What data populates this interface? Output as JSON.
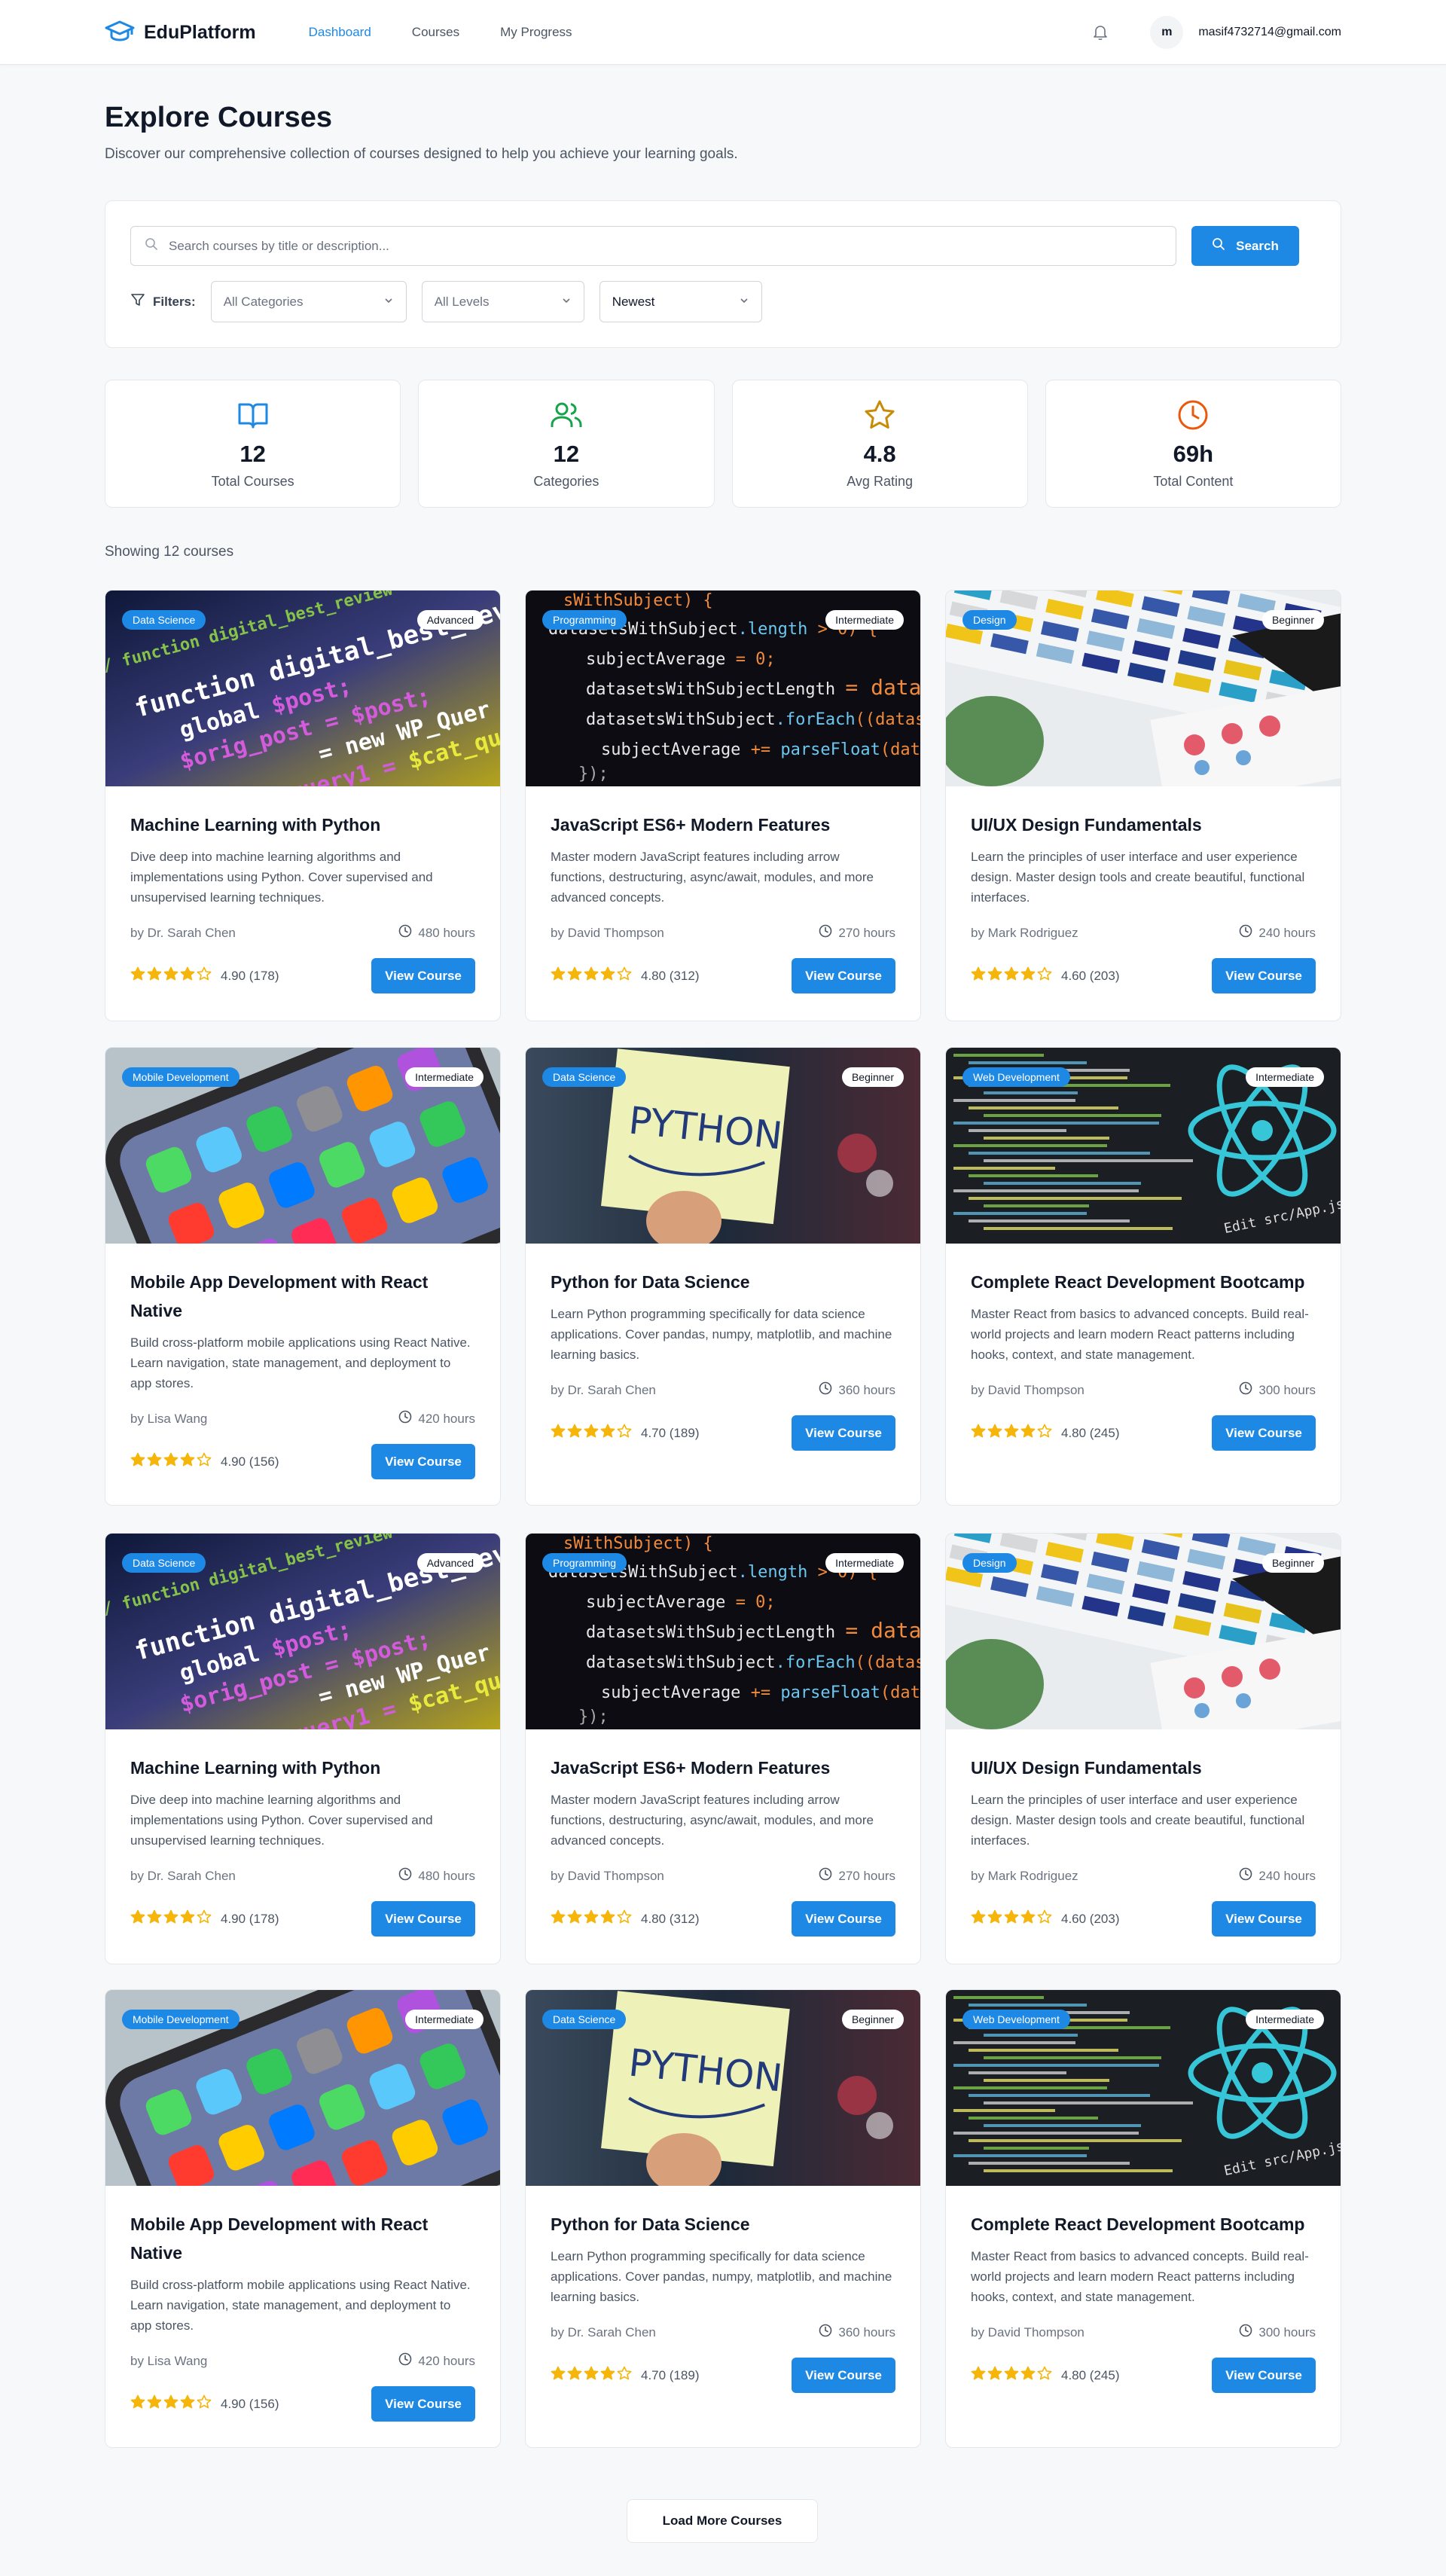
{
  "nav": {
    "brand": "EduPlatform",
    "links": [
      "Dashboard",
      "Courses",
      "My Progress"
    ],
    "active": "Dashboard",
    "avatar_initial": "m",
    "user_email": "masif4732714@gmail.com"
  },
  "header": {
    "title": "Explore Courses",
    "subtitle": "Discover our comprehensive collection of courses designed to help you achieve your learning goals."
  },
  "search": {
    "placeholder": "Search courses by title or description...",
    "button_label": "Search",
    "filters_label": "Filters:",
    "category_select": "All Categories",
    "level_select": "All Levels",
    "sort_select": "Newest"
  },
  "stats": [
    {
      "icon": "book-open-icon",
      "value": "12",
      "label": "Total Courses",
      "color": "#1e88e5"
    },
    {
      "icon": "users-icon",
      "value": "12",
      "label": "Categories",
      "color": "#16a34a"
    },
    {
      "icon": "star-outline-icon",
      "value": "4.8",
      "label": "Avg Rating",
      "color": "#ca8a04"
    },
    {
      "icon": "clock-icon",
      "value": "69h",
      "label": "Total Content",
      "color": "#ea580c"
    }
  ],
  "showing_text": "Showing 12 courses",
  "courses": [
    {
      "category": "Data Science",
      "level": "Advanced",
      "title": "Machine Learning with Python",
      "description": "Dive deep into machine learning algorithms and implementations using Python. Cover supervised and unsupervised learning techniques.",
      "instructor": "by Dr. Sarah Chen",
      "hours": "480 hours",
      "stars": 4,
      "rating": "4.90 (178)",
      "button": "View Course",
      "image": "code-wordpress"
    },
    {
      "category": "Programming",
      "level": "Intermediate",
      "title": "JavaScript ES6+ Modern Features",
      "description": "Master modern JavaScript features including arrow functions, destructuring, async/await, modules, and more advanced concepts.",
      "instructor": "by David Thompson",
      "hours": "270 hours",
      "stars": 4,
      "rating": "4.80 (312)",
      "button": "View Course",
      "image": "code-javascript"
    },
    {
      "category": "Design",
      "level": "Beginner",
      "title": "UI/UX Design Fundamentals",
      "description": "Learn the principles of user interface and user experience design. Master design tools and create beautiful, functional interfaces.",
      "instructor": "by Mark Rodriguez",
      "hours": "240 hours",
      "stars": 4,
      "rating": "4.60 (203)",
      "button": "View Course",
      "image": "design-swatches"
    },
    {
      "category": "Mobile Development",
      "level": "Intermediate",
      "title": "Mobile App Development with React Native",
      "description": "Build cross-platform mobile applications using React Native. Learn navigation, state management, and deployment to app stores.",
      "instructor": "by Lisa Wang",
      "hours": "420 hours",
      "stars": 4,
      "rating": "4.90 (156)",
      "button": "View Course",
      "image": "phone-apps"
    },
    {
      "category": "Data Science",
      "level": "Beginner",
      "title": "Python for Data Science",
      "description": "Learn Python programming specifically for data science applications. Cover pandas, numpy, matplotlib, and machine learning basics.",
      "instructor": "by Dr. Sarah Chen",
      "hours": "360 hours",
      "stars": 4,
      "rating": "4.70 (189)",
      "button": "View Course",
      "image": "python-note"
    },
    {
      "category": "Web Development",
      "level": "Intermediate",
      "title": "Complete React Development Bootcamp",
      "description": "Master React from basics to advanced concepts. Build real-world projects and learn modern React patterns including hooks, context, and state management.",
      "instructor": "by David Thompson",
      "hours": "300 hours",
      "stars": 4,
      "rating": "4.80 (245)",
      "button": "View Course",
      "image": "react-screen"
    },
    {
      "category": "Data Science",
      "level": "Advanced",
      "title": "Machine Learning with Python",
      "description": "Dive deep into machine learning algorithms and implementations using Python. Cover supervised and unsupervised learning techniques.",
      "instructor": "by Dr. Sarah Chen",
      "hours": "480 hours",
      "stars": 4,
      "rating": "4.90 (178)",
      "button": "View Course",
      "image": "code-wordpress"
    },
    {
      "category": "Programming",
      "level": "Intermediate",
      "title": "JavaScript ES6+ Modern Features",
      "description": "Master modern JavaScript features including arrow functions, destructuring, async/await, modules, and more advanced concepts.",
      "instructor": "by David Thompson",
      "hours": "270 hours",
      "stars": 4,
      "rating": "4.80 (312)",
      "button": "View Course",
      "image": "code-javascript"
    },
    {
      "category": "Design",
      "level": "Beginner",
      "title": "UI/UX Design Fundamentals",
      "description": "Learn the principles of user interface and user experience design. Master design tools and create beautiful, functional interfaces.",
      "instructor": "by Mark Rodriguez",
      "hours": "240 hours",
      "stars": 4,
      "rating": "4.60 (203)",
      "button": "View Course",
      "image": "design-swatches"
    },
    {
      "category": "Mobile Development",
      "level": "Intermediate",
      "title": "Mobile App Development with React Native",
      "description": "Build cross-platform mobile applications using React Native. Learn navigation, state management, and deployment to app stores.",
      "instructor": "by Lisa Wang",
      "hours": "420 hours",
      "stars": 4,
      "rating": "4.90 (156)",
      "button": "View Course",
      "image": "phone-apps"
    },
    {
      "category": "Data Science",
      "level": "Beginner",
      "title": "Python for Data Science",
      "description": "Learn Python programming specifically for data science applications. Cover pandas, numpy, matplotlib, and machine learning basics.",
      "instructor": "by Dr. Sarah Chen",
      "hours": "360 hours",
      "stars": 4,
      "rating": "4.70 (189)",
      "button": "View Course",
      "image": "python-note"
    },
    {
      "category": "Web Development",
      "level": "Intermediate",
      "title": "Complete React Development Bootcamp",
      "description": "Master React from basics to advanced concepts. Build real-world projects and learn modern React patterns including hooks, context, and state management.",
      "instructor": "by David Thompson",
      "hours": "300 hours",
      "stars": 4,
      "rating": "4.80 (245)",
      "button": "View Course",
      "image": "react-screen"
    }
  ],
  "load_more_label": "Load More Courses",
  "colors": {
    "accent": "#1e88e5",
    "star": "#f5b50a",
    "background": "#f7f8fa"
  }
}
